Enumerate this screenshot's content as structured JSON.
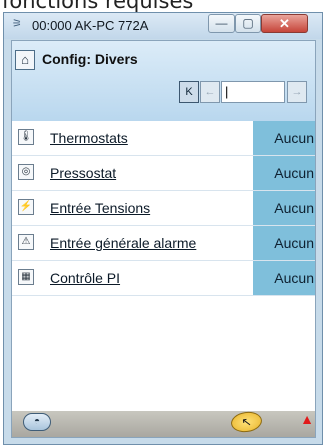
{
  "page_caption": "fonctions requises",
  "window": {
    "title": "00:000 AK-PC 772A",
    "icon": "connection-icon",
    "min_symbol": "—",
    "max_symbol": "▢",
    "close_symbol": "✕"
  },
  "header": {
    "title": "Config: Divers",
    "home_icon": "home-icon"
  },
  "pager": {
    "first_symbol": "K",
    "prev_symbol": "←",
    "input_value": "|",
    "next_symbol": "→"
  },
  "rows": [
    {
      "label": "Thermostats",
      "value": "Aucun",
      "icon": "thermostat-icon",
      "glyph": "🌡"
    },
    {
      "label": "Pressostat",
      "value": "Aucun",
      "icon": "pressure-gauge-icon",
      "glyph": "◎"
    },
    {
      "label": "Entrée Tensions",
      "value": "Aucun",
      "icon": "voltage-input-icon",
      "glyph": "⚡"
    },
    {
      "label": "Entrée générale alarme",
      "value": "Aucun",
      "icon": "alarm-input-icon",
      "glyph": "⚠"
    },
    {
      "label": "Contrôle PI",
      "value": "Aucun",
      "icon": "pi-control-icon",
      "glyph": "▦"
    }
  ],
  "bottom_bar": {
    "left_glyph": "◓",
    "mid_glyph": "↖",
    "right_glyph": "▲"
  },
  "colors": {
    "header_bg": "#b9d7ee",
    "value_cell": "#7fbfdb",
    "close_button": "#c6453a",
    "alarm": "#e11919",
    "window_frame": "#c7dbea"
  }
}
